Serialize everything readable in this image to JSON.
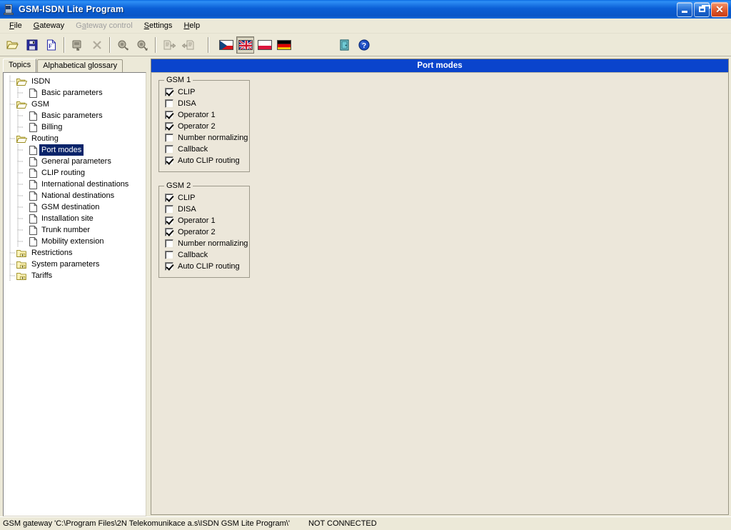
{
  "window": {
    "title": "GSM-ISDN Lite Program",
    "icon": "gateway-device-icon",
    "buttons": {
      "minimize": "Minimize",
      "restore": "Restore",
      "close": "Close"
    }
  },
  "menubar": {
    "items": [
      {
        "label": "File",
        "accel": "F",
        "disabled": false
      },
      {
        "label": "Gateway",
        "accel": "G",
        "disabled": false
      },
      {
        "label": "Gateway control",
        "accel": "a",
        "disabled": true
      },
      {
        "label": "Settings",
        "accel": "S",
        "disabled": false
      },
      {
        "label": "Help",
        "accel": "H",
        "disabled": false
      }
    ]
  },
  "toolbar": {
    "groups": [
      {
        "buttons": [
          {
            "name": "open-folder-icon",
            "title": "Open",
            "disabled": false
          },
          {
            "name": "save-icon",
            "title": "Save",
            "disabled": false
          },
          {
            "name": "new-document-icon",
            "title": "New configuration",
            "disabled": false
          }
        ]
      },
      {
        "buttons": [
          {
            "name": "connect-gateway-icon",
            "title": "Connect",
            "disabled": true
          },
          {
            "name": "disconnect-gateway-icon",
            "title": "Disconnect",
            "disabled": true
          }
        ]
      },
      {
        "buttons": [
          {
            "name": "read-config-icon",
            "title": "Read configuration",
            "disabled": true
          },
          {
            "name": "write-config-icon",
            "title": "Write configuration",
            "disabled": true
          }
        ]
      },
      {
        "buttons": [
          {
            "name": "upload-document-icon",
            "title": "Upload",
            "disabled": true
          },
          {
            "name": "download-document-icon",
            "title": "Download",
            "disabled": true
          }
        ]
      },
      {
        "buttons": [
          {
            "name": "flag-czech-icon",
            "title": "Czech",
            "selected": false
          },
          {
            "name": "flag-uk-icon",
            "title": "English",
            "selected": true
          },
          {
            "name": "flag-poland-icon",
            "title": "Polish",
            "selected": false
          },
          {
            "name": "flag-germany-icon",
            "title": "German",
            "selected": false
          }
        ]
      },
      {
        "buttons": [
          {
            "name": "exit-door-icon",
            "title": "Exit",
            "disabled": false
          },
          {
            "name": "help-question-icon",
            "title": "Help",
            "disabled": false
          }
        ]
      }
    ]
  },
  "leftpane": {
    "tabs": [
      {
        "label": "Topics",
        "active": true
      },
      {
        "label": "Alphabetical glossary",
        "active": false
      }
    ],
    "tree": [
      {
        "label": "ISDN",
        "type": "folder-open",
        "depth": 0,
        "selected": false
      },
      {
        "label": "Basic parameters",
        "type": "page",
        "depth": 1,
        "selected": false
      },
      {
        "label": "GSM",
        "type": "folder-open",
        "depth": 0,
        "selected": false
      },
      {
        "label": "Basic parameters",
        "type": "page",
        "depth": 1,
        "selected": false
      },
      {
        "label": "Billing",
        "type": "page",
        "depth": 1,
        "selected": false
      },
      {
        "label": "Routing",
        "type": "folder-open",
        "depth": 0,
        "selected": false
      },
      {
        "label": "Port modes",
        "type": "page",
        "depth": 1,
        "selected": true
      },
      {
        "label": "General parameters",
        "type": "page",
        "depth": 1,
        "selected": false
      },
      {
        "label": "CLIP routing",
        "type": "page",
        "depth": 1,
        "selected": false
      },
      {
        "label": "International destinations",
        "type": "page",
        "depth": 1,
        "selected": false
      },
      {
        "label": "National destinations",
        "type": "page",
        "depth": 1,
        "selected": false
      },
      {
        "label": "GSM destination",
        "type": "page",
        "depth": 1,
        "selected": false
      },
      {
        "label": "Installation site",
        "type": "page",
        "depth": 1,
        "selected": false
      },
      {
        "label": "Trunk number",
        "type": "page",
        "depth": 1,
        "selected": false
      },
      {
        "label": "Mobility extension",
        "type": "page",
        "depth": 1,
        "selected": false
      },
      {
        "label": "Restrictions",
        "type": "folder-closed",
        "depth": 0,
        "selected": false
      },
      {
        "label": "System parameters",
        "type": "folder-closed",
        "depth": 0,
        "selected": false
      },
      {
        "label": "Tariffs",
        "type": "folder-closed",
        "depth": 0,
        "selected": false
      }
    ]
  },
  "page": {
    "header": "Port modes",
    "groups": [
      {
        "title": "GSM 1",
        "options": [
          {
            "label": "CLIP",
            "checked": true
          },
          {
            "label": "DISA",
            "checked": false
          },
          {
            "label": "Operator 1",
            "checked": true
          },
          {
            "label": "Operator 2",
            "checked": true
          },
          {
            "label": "Number normalizing",
            "checked": false
          },
          {
            "label": "Callback",
            "checked": false
          },
          {
            "label": "Auto CLIP routing",
            "checked": true
          }
        ]
      },
      {
        "title": "GSM 2",
        "options": [
          {
            "label": "CLIP",
            "checked": true
          },
          {
            "label": "DISA",
            "checked": false
          },
          {
            "label": "Operator 1",
            "checked": true
          },
          {
            "label": "Operator 2",
            "checked": true
          },
          {
            "label": "Number normalizing",
            "checked": false
          },
          {
            "label": "Callback",
            "checked": false
          },
          {
            "label": "Auto CLIP routing",
            "checked": true
          }
        ]
      }
    ]
  },
  "statusbar": {
    "path": "GSM gateway 'C:\\Program Files\\2N Telekomunikace a.s\\ISDN GSM Lite Program\\'",
    "connection": "NOT CONNECTED"
  },
  "colors": {
    "titlebar_blue": "#0a5fd6",
    "page_header_blue": "#0a44cc",
    "selection_blue": "#0a246a",
    "face": "#ece9d8",
    "panel": "#ece7da",
    "close_red": "#e05a2c"
  }
}
